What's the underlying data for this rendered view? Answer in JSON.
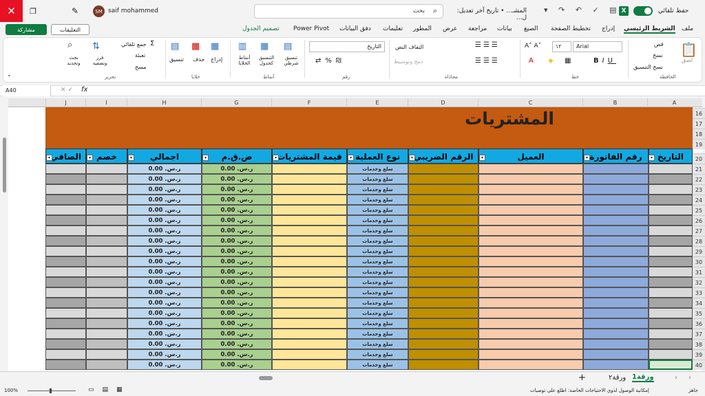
{
  "titlebar": {
    "user_name": "saif mohammed",
    "user_initials": "SM",
    "search_label": "بحث",
    "filename": "المشـ... • تاريخ آخر تعديل: ل...",
    "autosave_label": "حفظ تلقائي",
    "excel_letter": "X"
  },
  "tabs": {
    "file": "ملف",
    "home": "الشريط الرئيسي",
    "insert": "إدراج",
    "page_layout": "تخطيط الصفحة",
    "formulas": "الصيغ",
    "data": "بيانات",
    "review": "مراجعة",
    "view": "عرض",
    "developer": "المطور",
    "help": "تعليمات",
    "data_flow": "دفق البيانات",
    "power_pivot": "Power Pivot",
    "table_design": "تصميم الجدول",
    "share": "مشاركة",
    "comments": "التعليقات"
  },
  "ribbon": {
    "clipboard": "الحافظة",
    "paste": "لصق",
    "cut": "قص",
    "copy": "نسخ",
    "format_painter": "نسخ التنسيق",
    "font_group": "خط",
    "font_name": "Arial",
    "font_size": "١٢",
    "alignment_group": "محاذاة",
    "wrap_text": "التفاف النص",
    "merge": "دمج وتوسيط",
    "number_group": "رقم",
    "number_format": "التاريخ",
    "styles_group": "أنماط",
    "cond_format": "تنسيق شرطي",
    "format_table": "التنسيق كجدول",
    "cell_styles": "أنماط الخلايا",
    "cells_group": "خلايا",
    "insert_cells": "إدراج",
    "delete_cells": "حذف",
    "format_cells": "تنسيق",
    "editing_group": "تحرير",
    "autosum": "جمع تلقائي",
    "fill": "تعبئة",
    "clear": "مسح",
    "sort_filter": "فرز وتصفية",
    "find_select": "بحث وتحديد"
  },
  "formula_bar": {
    "name_box": "A40",
    "fx": "fx",
    "formula": ""
  },
  "columns": [
    "A",
    "B",
    "C",
    "D",
    "E",
    "F",
    "G",
    "H",
    "I",
    "J"
  ],
  "row_numbers": [
    "16",
    "17",
    "18",
    "19",
    "20",
    "21",
    "22",
    "23",
    "24",
    "25",
    "26",
    "27",
    "28",
    "29",
    "30",
    "31",
    "32",
    "33",
    "34",
    "35",
    "36",
    "37",
    "38",
    "39",
    "40"
  ],
  "sheet_title": "المشتريات",
  "headers": {
    "date": "التاريخ",
    "invoice_no": "رقم الفاتورة",
    "customer": "العميل",
    "tax_no": "الرقم الضريبي",
    "op_type": "نوع العملية",
    "purchase_value": "قيمة المشتريات",
    "vat": "ض.ق.م",
    "total": "اجمالي",
    "discount": "خصم",
    "net": "الصافي"
  },
  "cell_values": {
    "op_type": "سلع وخدمات",
    "vat": "ر.س. 0.00",
    "total": "ر.س. 0.00"
  },
  "sheettabs": {
    "sheet1": "ورقة1",
    "sheet2": "ورقة٢",
    "add": "+"
  },
  "status": {
    "ready": "جاهز",
    "accessibility": "إمكانية الوصول لذوي الاحتياجات الخاصة: اطلع على توصيات",
    "zoom": "100%"
  }
}
